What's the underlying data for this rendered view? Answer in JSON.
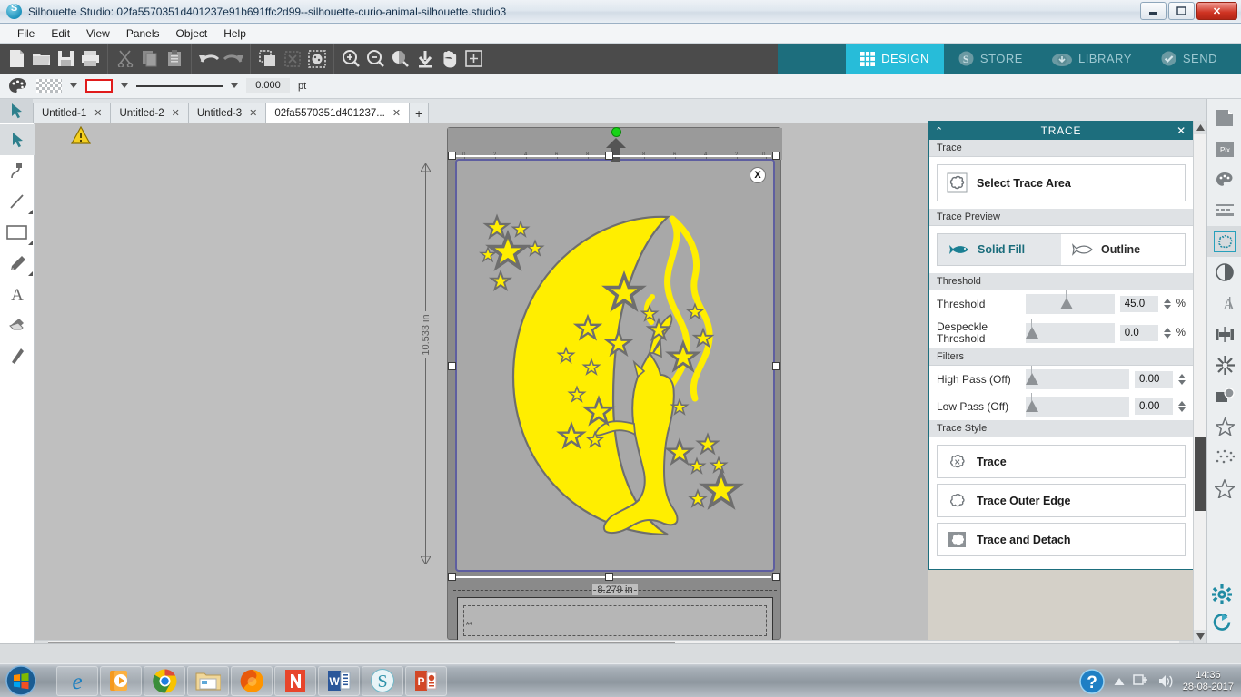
{
  "window": {
    "title": "Silhouette Studio: 02fa5570351d401237e91b691ffc2d99--silhouette-curio-animal-silhouette.studio3",
    "minimize": "—",
    "maximize": "❐",
    "close": "✕"
  },
  "menu": {
    "items": [
      "File",
      "Edit",
      "View",
      "Panels",
      "Object",
      "Help"
    ]
  },
  "toolbar": {
    "groups": [
      [
        "new-document-icon",
        "open-folder-icon",
        "save-icon",
        "print-icon"
      ],
      [
        "cut-scissors-icon",
        "copy-icon",
        "paste-clipboard-icon"
      ],
      [
        "undo-arrow-icon",
        "redo-arrow-icon"
      ],
      [
        "duplicate-icon",
        "delete-icon",
        "paste-in-front-icon"
      ],
      [
        "zoom-in-icon",
        "zoom-out-icon",
        "zoom-selection-icon",
        "fit-to-page-icon",
        "pan-hand-icon",
        "zoom-region-icon"
      ]
    ]
  },
  "modes": [
    {
      "label": "DESIGN",
      "icon": "grid-icon",
      "active": true
    },
    {
      "label": "STORE",
      "icon": "store-s-icon",
      "active": false
    },
    {
      "label": "LIBRARY",
      "icon": "cloud-download-icon",
      "active": false
    },
    {
      "label": "SEND",
      "icon": "check-circle-icon",
      "active": false
    }
  ],
  "stylebar": {
    "palette_icon": "palette-icon",
    "fill_swatch": "no-fill-crosshatch",
    "line_color": "#e01b1b",
    "line_weight_value": "0.000",
    "line_weight_unit": "pt"
  },
  "doc_tabs": [
    {
      "label": "Untitled-1",
      "close": "✕",
      "active": false
    },
    {
      "label": "Untitled-2",
      "close": "✕",
      "active": false
    },
    {
      "label": "Untitled-3",
      "close": "✕",
      "active": false
    },
    {
      "label": "02fa5570351d401237...",
      "close": "✕",
      "active": true
    }
  ],
  "add_tab_label": "+",
  "left_tools": [
    {
      "name": "select-arrow-tool",
      "active": true
    },
    {
      "name": "edit-points-tool",
      "active": false
    },
    {
      "name": "line-tool",
      "active": false
    },
    {
      "name": "rectangle-tool",
      "active": false
    },
    {
      "name": "draw-pencil-tool",
      "active": false
    },
    {
      "name": "text-tool",
      "active": false
    },
    {
      "name": "eraser-tool",
      "active": false
    },
    {
      "name": "knife-tool",
      "active": false
    }
  ],
  "canvas": {
    "warning_icon": "warning-triangle-icon",
    "close_badge": "X",
    "width_label": "8.279 in",
    "height_label": "10.533 in",
    "mat_label": "A4",
    "ruler_ticks": [
      "0",
      "2",
      "4",
      "6",
      "8",
      "8",
      "6",
      "4",
      "2",
      "0"
    ],
    "artwork": {
      "name": "cat-moon-stars-silhouette",
      "fill_color": "#ffee00",
      "background_color": "#a8a8a8"
    }
  },
  "trace_panel": {
    "title": "TRACE",
    "collapse_icon": "chevron-up-icon",
    "close_icon": "close-icon",
    "sections": {
      "trace": {
        "header": "Trace",
        "select_area_label": "Select Trace Area",
        "select_area_icon": "trace-area-icon"
      },
      "trace_preview": {
        "header": "Trace Preview",
        "solid_fill_label": "Solid Fill",
        "solid_fill_icon": "fish-solid-icon",
        "outline_label": "Outline",
        "outline_icon": "fish-outline-icon"
      },
      "threshold": {
        "header": "Threshold",
        "threshold_label": "Threshold",
        "threshold_value": "45.0",
        "threshold_unit": "%",
        "despeckle_label": "Despeckle Threshold",
        "despeckle_value": "0.0",
        "despeckle_unit": "%"
      },
      "filters": {
        "header": "Filters",
        "high_pass_label": "High Pass (Off)",
        "high_pass_value": "0.00",
        "low_pass_label": "Low Pass (Off)",
        "low_pass_value": "0.00"
      },
      "trace_style": {
        "header": "Trace Style",
        "trace_label": "Trace",
        "trace_icon": "trace-icon",
        "outer_edge_label": "Trace Outer Edge",
        "outer_edge_icon": "trace-outer-edge-icon",
        "detach_label": "Trace and Detach",
        "detach_icon": "trace-detach-icon"
      }
    }
  },
  "right_icons": [
    {
      "name": "page-setup-icon",
      "active": false
    },
    {
      "name": "pixscan-icon",
      "active": false
    },
    {
      "name": "fill-color-icon",
      "active": false
    },
    {
      "name": "line-style-icon",
      "active": false
    },
    {
      "name": "trace-panel-icon",
      "active": true
    },
    {
      "name": "offset-icon",
      "active": false
    },
    {
      "name": "text-style-icon",
      "active": false
    },
    {
      "name": "align-icon",
      "active": false
    },
    {
      "name": "modify-icon",
      "active": false
    },
    {
      "name": "shadow-icon",
      "active": false
    },
    {
      "name": "sketch-star-icon",
      "active": false
    },
    {
      "name": "stipple-icon",
      "active": false
    },
    {
      "name": "rhinestone-icon",
      "active": false
    }
  ],
  "bottom_right_icons": [
    {
      "name": "settings-gear-icon"
    },
    {
      "name": "sync-refresh-icon"
    }
  ],
  "taskbar": {
    "start_label": "start-orb-icon",
    "apps": [
      {
        "name": "internet-explorer-icon"
      },
      {
        "name": "media-player-icon"
      },
      {
        "name": "google-chrome-icon"
      },
      {
        "name": "file-explorer-icon"
      },
      {
        "name": "firefox-icon"
      },
      {
        "name": "nitro-pdf-icon"
      },
      {
        "name": "microsoft-word-icon"
      },
      {
        "name": "silhouette-studio-icon"
      },
      {
        "name": "powerpoint-icon"
      }
    ],
    "tray": {
      "help_icon": "help-question-icon",
      "expand_icon": "show-hidden-icons-icon",
      "network_icon": "network-icon",
      "volume_icon": "volume-icon",
      "time": "14:36",
      "date": "28-08-2017"
    }
  }
}
